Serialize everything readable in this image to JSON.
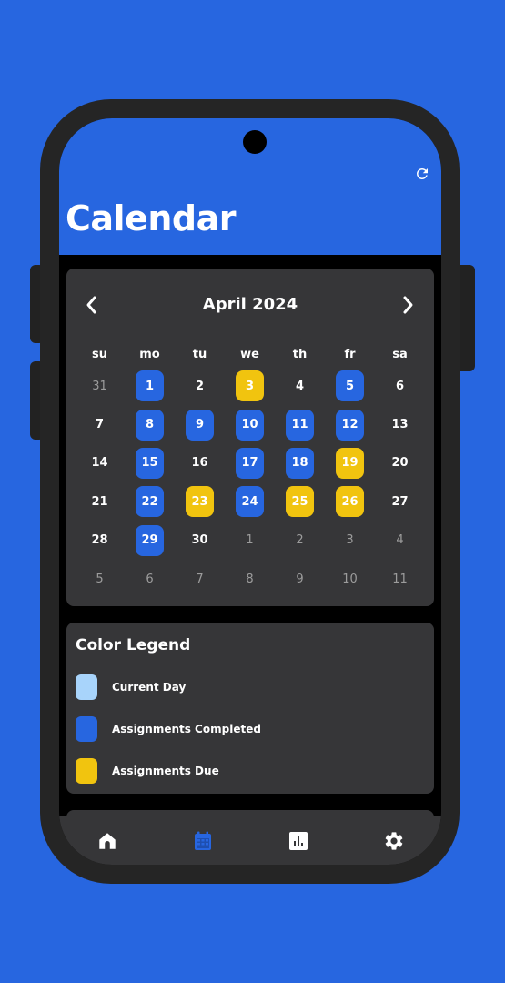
{
  "colors": {
    "background": "#2766e0",
    "card": "#363638",
    "current_day": "#a8d4fb",
    "completed": "#2766e0",
    "due": "#f1c40f"
  },
  "header": {
    "title": "Calendar",
    "refresh_icon": "refresh-icon"
  },
  "calendar": {
    "month_label": "April 2024",
    "prev_icon": "chevron-left-icon",
    "next_icon": "chevron-right-icon",
    "weekdays": [
      "su",
      "mo",
      "tu",
      "we",
      "th",
      "fr",
      "sa"
    ],
    "days": [
      {
        "label": "31",
        "state": "other"
      },
      {
        "label": "1",
        "state": "completed"
      },
      {
        "label": "2",
        "state": "normal"
      },
      {
        "label": "3",
        "state": "due"
      },
      {
        "label": "4",
        "state": "normal"
      },
      {
        "label": "5",
        "state": "completed"
      },
      {
        "label": "6",
        "state": "normal"
      },
      {
        "label": "7",
        "state": "normal"
      },
      {
        "label": "8",
        "state": "completed"
      },
      {
        "label": "9",
        "state": "completed"
      },
      {
        "label": "10",
        "state": "completed"
      },
      {
        "label": "11",
        "state": "completed"
      },
      {
        "label": "12",
        "state": "completed"
      },
      {
        "label": "13",
        "state": "normal"
      },
      {
        "label": "14",
        "state": "normal"
      },
      {
        "label": "15",
        "state": "completed"
      },
      {
        "label": "16",
        "state": "normal"
      },
      {
        "label": "17",
        "state": "completed"
      },
      {
        "label": "18",
        "state": "completed"
      },
      {
        "label": "19",
        "state": "due"
      },
      {
        "label": "20",
        "state": "normal"
      },
      {
        "label": "21",
        "state": "normal"
      },
      {
        "label": "22",
        "state": "completed"
      },
      {
        "label": "23",
        "state": "due"
      },
      {
        "label": "24",
        "state": "completed"
      },
      {
        "label": "25",
        "state": "due"
      },
      {
        "label": "26",
        "state": "due"
      },
      {
        "label": "27",
        "state": "normal"
      },
      {
        "label": "28",
        "state": "normal"
      },
      {
        "label": "29",
        "state": "completed"
      },
      {
        "label": "30",
        "state": "normal"
      },
      {
        "label": "1",
        "state": "other"
      },
      {
        "label": "2",
        "state": "other"
      },
      {
        "label": "3",
        "state": "other"
      },
      {
        "label": "4",
        "state": "other"
      },
      {
        "label": "5",
        "state": "other"
      },
      {
        "label": "6",
        "state": "other"
      },
      {
        "label": "7",
        "state": "other"
      },
      {
        "label": "8",
        "state": "other"
      },
      {
        "label": "9",
        "state": "other"
      },
      {
        "label": "10",
        "state": "other"
      },
      {
        "label": "11",
        "state": "other"
      }
    ]
  },
  "legend": {
    "title": "Color Legend",
    "items": [
      {
        "label": "Current Day",
        "color": "#a8d4fb"
      },
      {
        "label": "Assignments Completed",
        "color": "#2766e0"
      },
      {
        "label": "Assignments Due",
        "color": "#f1c40f"
      }
    ]
  },
  "bottom_nav": [
    {
      "icon": "home-icon",
      "active": false
    },
    {
      "icon": "calendar-icon",
      "active": true
    },
    {
      "icon": "bar-chart-icon",
      "active": false
    },
    {
      "icon": "gear-icon",
      "active": false
    }
  ]
}
